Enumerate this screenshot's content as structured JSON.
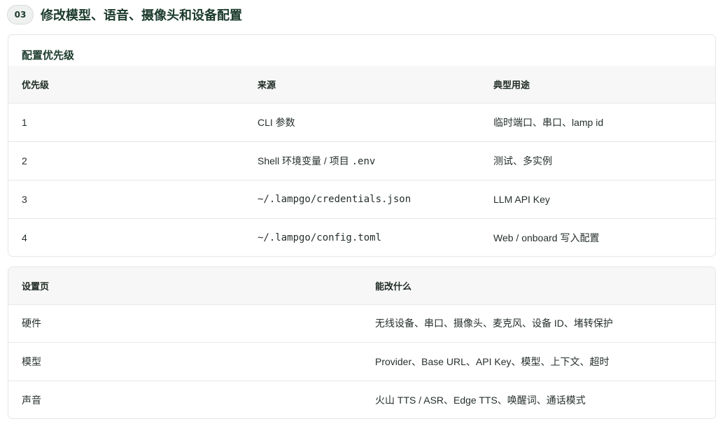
{
  "section": {
    "step": "03",
    "title": "修改模型、语音、摄像头和设备配置"
  },
  "priority_card": {
    "title": "配置优先级",
    "headers": [
      "优先级",
      "来源",
      "典型用途"
    ],
    "rows": [
      {
        "priority": "1",
        "source_text": "CLI 参数",
        "source_code": "",
        "usage": "临时端口、串口、lamp id"
      },
      {
        "priority": "2",
        "source_text": "Shell 环境变量 / 项目 ",
        "source_code": ".env",
        "usage": "测试、多实例"
      },
      {
        "priority": "3",
        "source_text": "",
        "source_code": "~/.lampgo/credentials.json",
        "usage": "LLM API Key"
      },
      {
        "priority": "4",
        "source_text": "",
        "source_code": "~/.lampgo/config.toml",
        "usage": "Web / onboard 写入配置"
      }
    ]
  },
  "settings_card": {
    "headers": [
      "设置页",
      "能改什么"
    ],
    "rows": [
      {
        "page": "硬件",
        "changes": "无线设备、串口、摄像头、麦克风、设备 ID、堵转保护"
      },
      {
        "page": "模型",
        "changes": "Provider、Base URL、API Key、模型、上下文、超时"
      },
      {
        "page": "声音",
        "changes": "火山 TTS / ASR、Edge TTS、唤醒词、通话模式"
      }
    ]
  }
}
